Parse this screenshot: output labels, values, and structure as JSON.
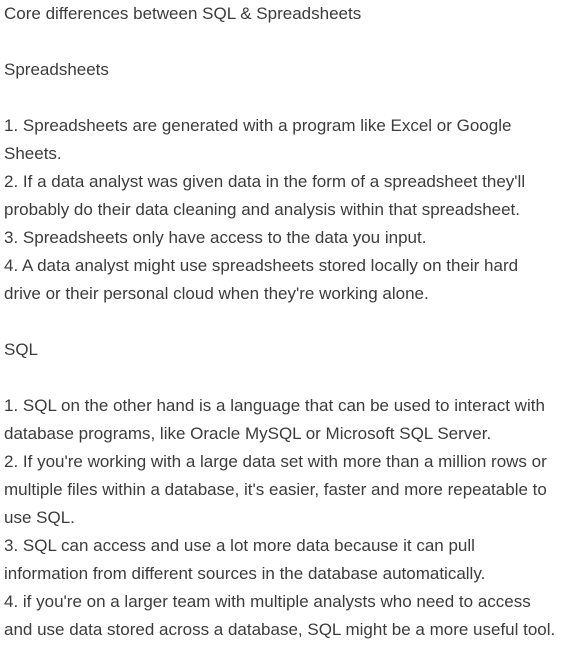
{
  "title": "Core differences between SQL & Spreadsheets",
  "spreadsheets": {
    "heading": "Spreadsheets",
    "items": [
      "1. Spreadsheets are generated with a program like Excel or Google Sheets.",
      "2. If a data analyst was given data in the form of a spreadsheet they'll probably do their data cleaning and analysis within that spreadsheet.",
      "3. Spreadsheets only have access to the data you input.",
      "4. A data analyst might use spreadsheets stored locally on their hard drive or their personal cloud when they're working alone."
    ]
  },
  "sql": {
    "heading": "SQL",
    "items": [
      "1. SQL on the other hand is a language that can be used to interact with database programs, like Oracle MySQL or Microsoft SQL Server.",
      "2. If you're working with a large data set with more than a million rows or multiple files within a database, it's easier, faster and more repeatable to use SQL.",
      "3. SQL can access and use a lot more data because it can pull information from different sources in the database automatically.",
      "4. if you're on a larger team with multiple analysts who need to access and use data stored across a database, SQL might be a more useful tool."
    ]
  }
}
